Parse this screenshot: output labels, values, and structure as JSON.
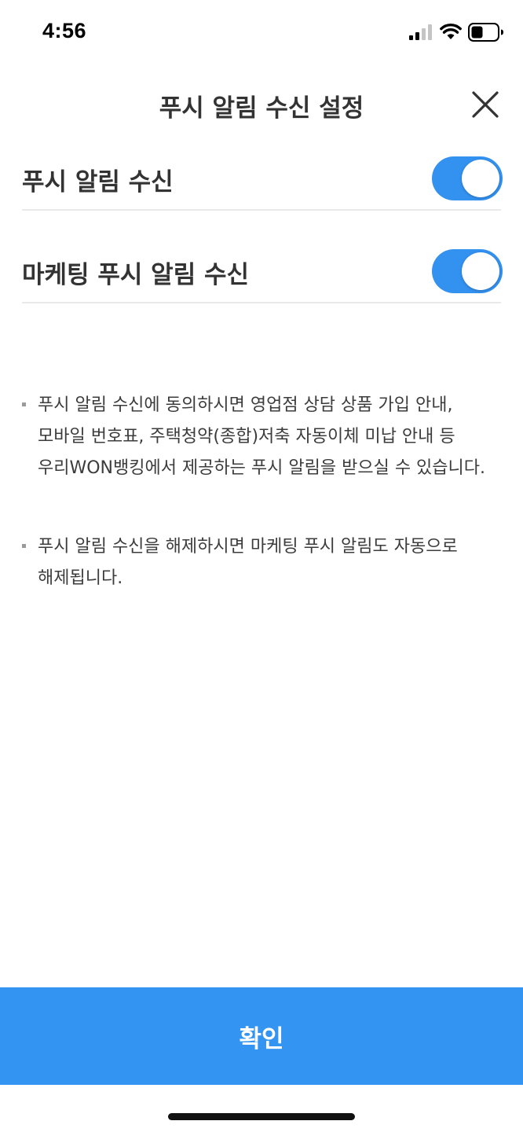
{
  "status_bar": {
    "time": "4:56",
    "signal_icon": "cellular-signal-icon",
    "wifi_icon": "wifi-icon",
    "battery_icon": "battery-icon"
  },
  "header": {
    "title": "푸시 알림 수신 설정",
    "close_icon": "close-icon"
  },
  "settings": [
    {
      "label": "푸시 알림 수신",
      "enabled": true
    },
    {
      "label": "마케팅 푸시 알림 수신",
      "enabled": true
    }
  ],
  "notices": [
    "푸시 알림 수신에 동의하시면 영업점 상담 상품 가입 안내, 모바일 번호표, 주택청약(종합)저축 자동이체 미납 안내 등 우리WON뱅킹에서 제공하는 푸시 알림을 받으실 수 있습니다.",
    "푸시 알림 수신을 해제하시면 마케팅 푸시 알림도 자동으로 해제됩니다."
  ],
  "confirm_label": "확인",
  "colors": {
    "accent": "#3494f2",
    "toggle_on": "#3391f0",
    "divider": "#e9e9e9"
  }
}
